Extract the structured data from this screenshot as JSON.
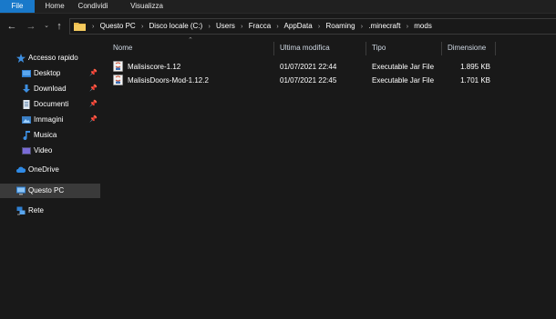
{
  "ribbon": {
    "tabs": [
      {
        "label": "File"
      },
      {
        "label": "Home"
      },
      {
        "label": "Condividi"
      },
      {
        "label": "Visualizza"
      }
    ],
    "file_color": "#1979ca"
  },
  "address": {
    "crumbs": [
      "Questo PC",
      "Disco locale (C:)",
      "Users",
      "Fracca",
      "AppData",
      "Roaming",
      ".minecraft",
      "mods"
    ]
  },
  "sidebar": {
    "items": [
      {
        "label": "Accesso rapido",
        "icon": "star-icon"
      },
      {
        "label": "Desktop",
        "icon": "desktop-folder-icon",
        "pinned": true
      },
      {
        "label": "Download",
        "icon": "download-arrow-icon",
        "pinned": true
      },
      {
        "label": "Documenti",
        "icon": "documents-icon",
        "pinned": true
      },
      {
        "label": "Immagini",
        "icon": "pictures-icon",
        "pinned": true
      },
      {
        "label": "Musica",
        "icon": "music-note-icon"
      },
      {
        "label": "Video",
        "icon": "video-icon"
      },
      {
        "label": "OneDrive",
        "icon": "cloud-icon"
      },
      {
        "label": "Questo PC",
        "icon": "computer-icon",
        "selected": true
      },
      {
        "label": "Rete",
        "icon": "network-icon"
      }
    ]
  },
  "columns": {
    "name": "Nome",
    "modified": "Ultima modifica",
    "type": "Tipo",
    "size": "Dimensione"
  },
  "files": [
    {
      "name": "Malisiscore-1.12",
      "modified": "01/07/2021 22:44",
      "type": "Executable Jar File",
      "size": "1.895 KB"
    },
    {
      "name": "MalisisDoors-Mod-1.12.2",
      "modified": "01/07/2021 22:45",
      "type": "Executable Jar File",
      "size": "1.701 KB"
    }
  ]
}
